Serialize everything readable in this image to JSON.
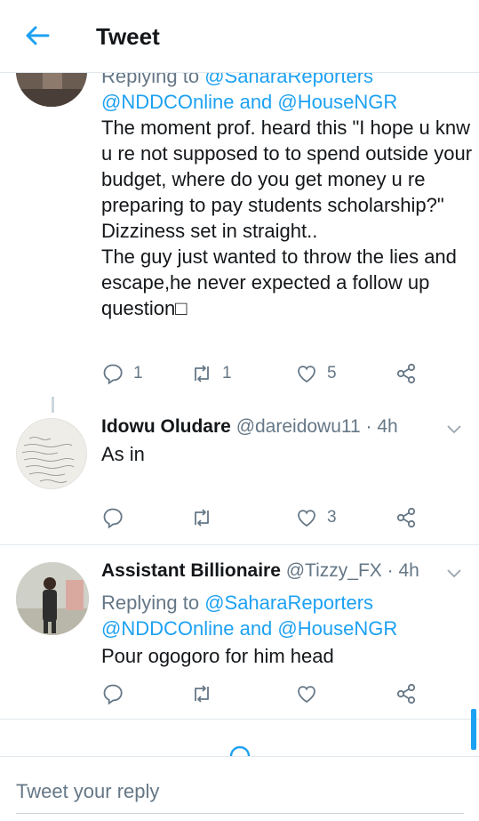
{
  "header": {
    "title": "Tweet"
  },
  "colors": {
    "accent": "#1da1f2",
    "secondary_text": "#657786",
    "divider": "#e1e8ed"
  },
  "tweets": [
    {
      "reply_prefix": "Replying to ",
      "reply_mentions_1": "@SaharaReporters",
      "reply_mentions_2": "@NDDCOnline and @HouseNGR",
      "text": "The moment prof. heard this \"I hope u knw u re not supposed to to spend outside your budget, where do you get money u re preparing to pay students scholarship?\"\nDizziness set in straight..\nThe guy just wanted to throw the lies and escape,he never expected a follow up question□",
      "replies": "1",
      "retweets": "1",
      "likes": "5"
    },
    {
      "name": "Idowu Oludare",
      "handle_time": "@dareidowu11 · 4h",
      "text": "As in",
      "replies": "",
      "retweets": "",
      "likes": "3"
    },
    {
      "name": "Assistant Billionaire",
      "handle_time": "@Tizzy_FX · 4h",
      "reply_prefix": "Replying to ",
      "reply_mentions_1": "@SaharaReporters",
      "reply_mentions_2": "@NDDCOnline and @HouseNGR",
      "text": "Pour ogogoro for him head",
      "replies": "",
      "retweets": "",
      "likes": ""
    }
  ],
  "composer": {
    "placeholder": "Tweet your reply"
  },
  "icons": [
    "back-arrow-icon",
    "reply-icon",
    "retweet-icon",
    "like-icon",
    "share-icon",
    "chevron-down-icon",
    "loading-spinner-icon"
  ]
}
